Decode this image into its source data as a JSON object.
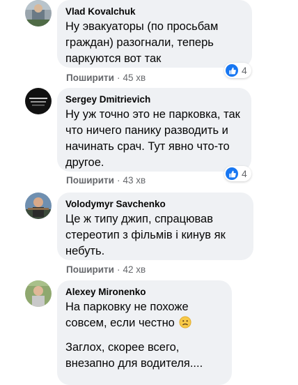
{
  "comments": [
    {
      "author": "Vlad Kovalchuk",
      "lines": [
        "Ну эвакуаторы (по просьбам граждан) разогнали, теперь паркуются вот так"
      ],
      "share_label": "Поширити",
      "time": "45 хв",
      "reaction_count": "4",
      "reaction_icon": "like-icon"
    },
    {
      "author": "Sergey Dmitrievich",
      "lines": [
        "Ну уж точно это не парковка, так что ничего панику разводить и начинать срач. Тут явно что-то другое."
      ],
      "share_label": "Поширити",
      "time": "43 хв",
      "reaction_count": "4",
      "reaction_icon": "like-icon"
    },
    {
      "author": "Volodymyr Savchenko",
      "lines": [
        "Це ж типу джип, спрацював стереотип з фільмів і кинув як небуть."
      ],
      "share_label": "Поширити",
      "time": "42 хв"
    },
    {
      "author": "Alexey Mironenko",
      "lines": [
        "На парковку не похоже совсем, если честно",
        "Заглох, скорее всего, внезапно для водителя...."
      ],
      "emoji": "slightly-frowning-face-icon"
    }
  ],
  "colors": {
    "bubble": "#eff1f4",
    "meta": "#65676b",
    "like": "#1877f2"
  }
}
